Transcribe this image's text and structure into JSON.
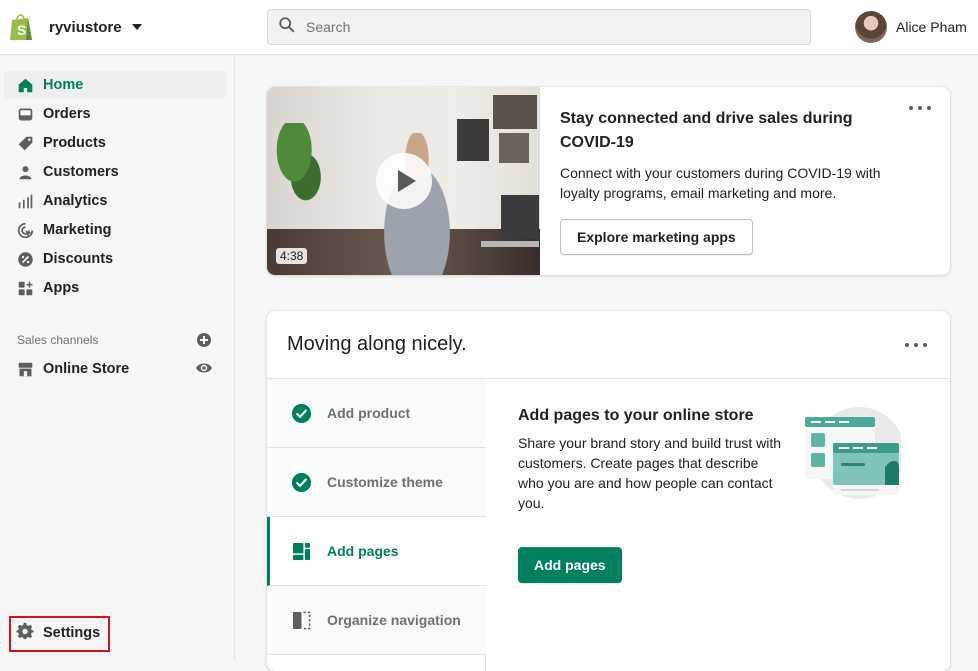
{
  "topbar": {
    "store_name": "ryviustore",
    "search_placeholder": "Search",
    "user_name": "Alice Pham"
  },
  "sidebar": {
    "items": [
      {
        "label": "Home",
        "icon": "home-icon",
        "active": true
      },
      {
        "label": "Orders",
        "icon": "inbox-icon",
        "active": false
      },
      {
        "label": "Products",
        "icon": "tag-icon",
        "active": false
      },
      {
        "label": "Customers",
        "icon": "person-icon",
        "active": false
      },
      {
        "label": "Analytics",
        "icon": "bar-chart-icon",
        "active": false
      },
      {
        "label": "Marketing",
        "icon": "target-icon",
        "active": false
      },
      {
        "label": "Discounts",
        "icon": "discount-icon",
        "active": false
      },
      {
        "label": "Apps",
        "icon": "apps-icon",
        "active": false
      }
    ],
    "sales_channels_label": "Sales channels",
    "channels": [
      {
        "label": "Online Store",
        "icon": "store-icon"
      }
    ],
    "settings_label": "Settings"
  },
  "covid_card": {
    "video_duration": "4:38",
    "title": "Stay connected and drive sales during COVID-19",
    "text": "Connect with your customers during COVID-19 with loyalty programs, email marketing and more.",
    "button_label": "Explore marketing apps"
  },
  "setup_card": {
    "title": "Moving along nicely.",
    "steps": [
      {
        "label": "Add product",
        "status": "complete"
      },
      {
        "label": "Customize theme",
        "status": "complete"
      },
      {
        "label": "Add pages",
        "status": "active"
      },
      {
        "label": "Organize navigation",
        "status": "incomplete"
      }
    ],
    "detail": {
      "title": "Add pages to your online store",
      "text": "Share your brand story and build trust with customers. Create pages that describe who you are and how people can contact you.",
      "button_label": "Add pages"
    }
  },
  "colors": {
    "brand_green": "#008060",
    "active_text": "#007f5f",
    "highlight_border": "#d8121c",
    "shopify_logo": "#95bf47"
  }
}
